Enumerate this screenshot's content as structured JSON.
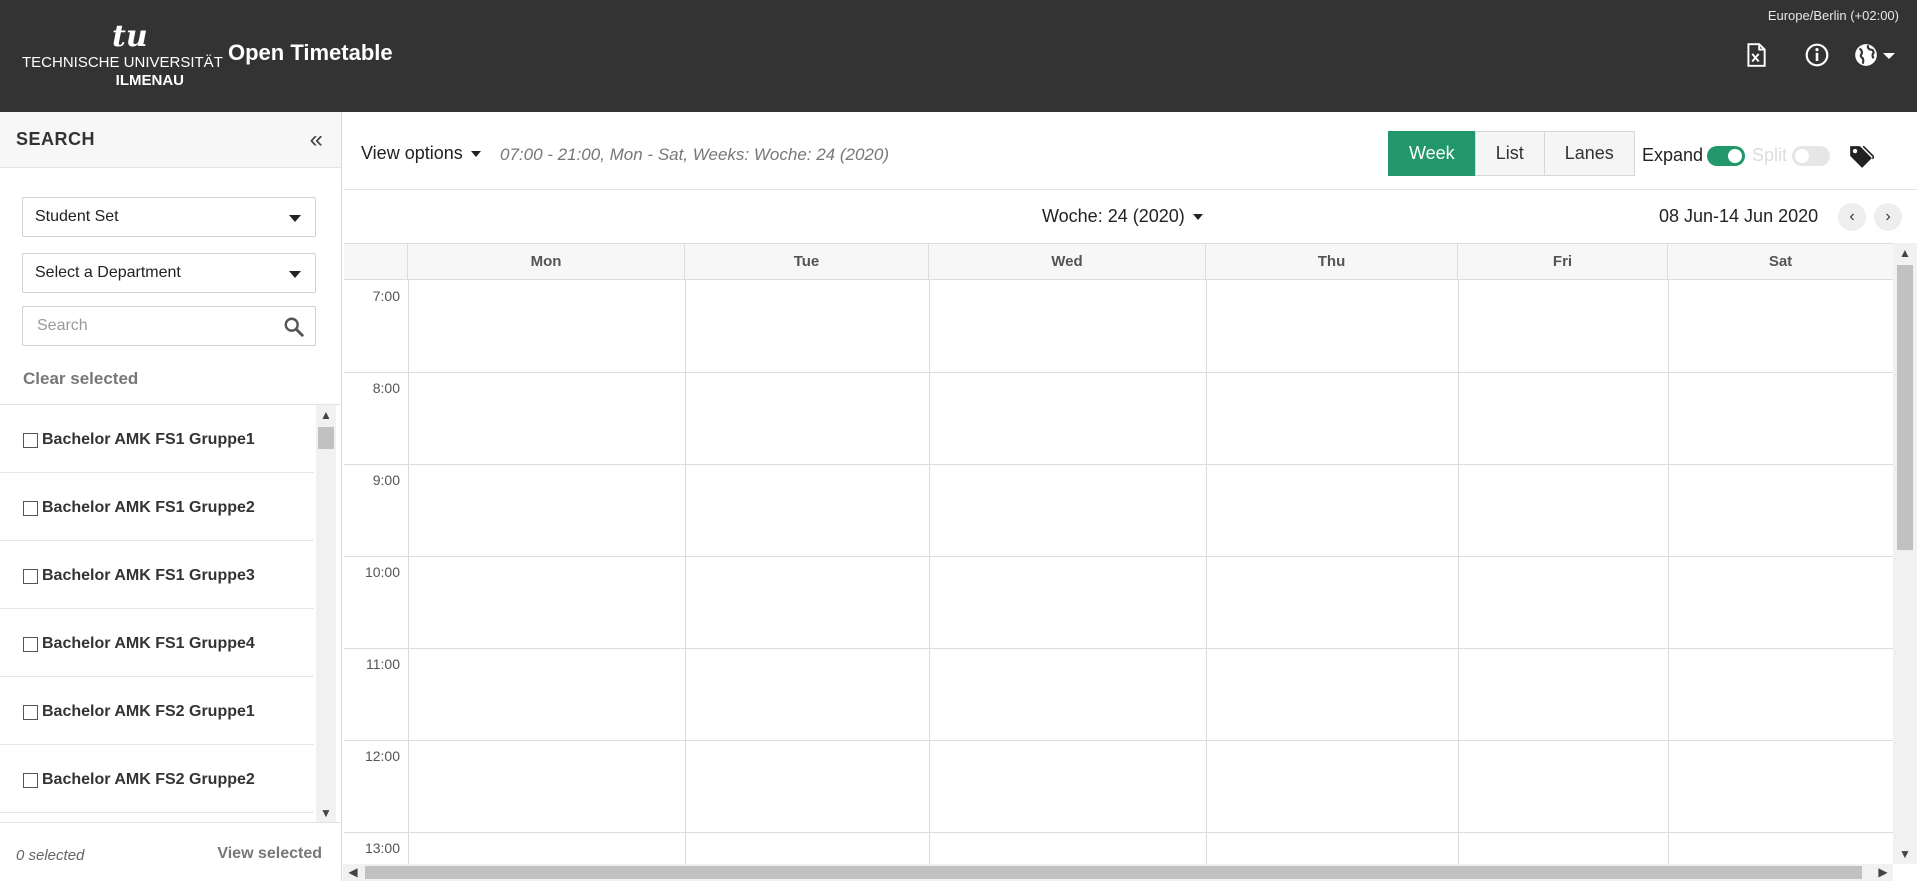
{
  "header": {
    "logo_mark": "tu",
    "logo_line1": "TECHNISCHE UNIVERSITÄT",
    "logo_line2": "ILMENAU",
    "app_title": "Open Timetable",
    "timezone": "Europe/Berlin (+02:00)",
    "icons": [
      "excel-export-icon",
      "info-icon",
      "globe-icon",
      "chevron-down-icon"
    ]
  },
  "sidebar": {
    "title": "SEARCH",
    "collapse_glyph": "«",
    "type_select": "Student Set",
    "department_select": "Select a Department",
    "search_placeholder": "Search",
    "clear_selected": "Clear selected",
    "items": [
      {
        "label": "Bachelor AMK FS1 Gruppe1",
        "checked": false
      },
      {
        "label": "Bachelor AMK FS1 Gruppe2",
        "checked": false
      },
      {
        "label": "Bachelor AMK FS1 Gruppe3",
        "checked": false
      },
      {
        "label": "Bachelor AMK FS1 Gruppe4",
        "checked": false
      },
      {
        "label": "Bachelor AMK FS2 Gruppe1",
        "checked": false
      },
      {
        "label": "Bachelor AMK FS2 Gruppe2",
        "checked": false
      }
    ],
    "selected_count": "0 selected",
    "view_selected": "View selected"
  },
  "toolbar": {
    "view_options": "View options",
    "summary": "07:00 - 21:00, Mon - Sat, Weeks: Woche: 24 (2020)",
    "views": [
      {
        "label": "Week",
        "active": true
      },
      {
        "label": "List",
        "active": false
      },
      {
        "label": "Lanes",
        "active": false
      }
    ],
    "expand_label": "Expand",
    "expand_on": true,
    "split_label": "Split",
    "split_on": false
  },
  "week": {
    "selector": "Woche: 24 (2020)",
    "date_range": "08 Jun-14 Jun 2020",
    "prev_glyph": "‹",
    "next_glyph": "›"
  },
  "calendar": {
    "days": [
      "Mon",
      "Tue",
      "Wed",
      "Thu",
      "Fri",
      "Sat"
    ],
    "times": [
      "7:00",
      "8:00",
      "9:00",
      "10:00",
      "11:00",
      "12:00",
      "13:00"
    ]
  },
  "colors": {
    "header_bg": "#333333",
    "accent": "#21976b",
    "border": "#dcdcdc"
  }
}
